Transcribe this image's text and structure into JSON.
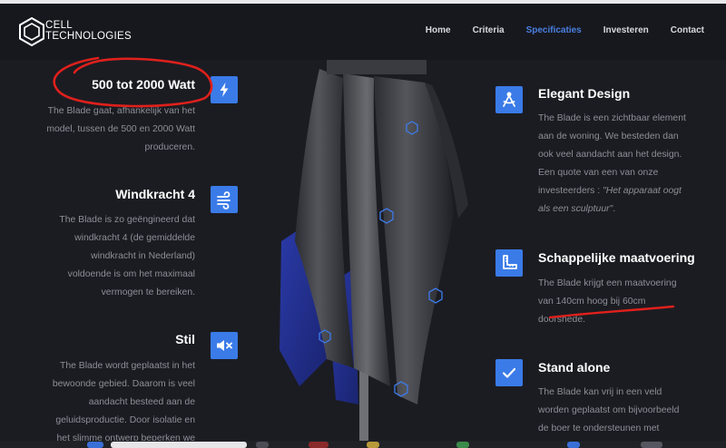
{
  "brand": {
    "line1": "CELL",
    "line2": "TECHNOLOGIES"
  },
  "nav": {
    "items": [
      "Home",
      "Criteria",
      "Specificaties",
      "Investeren",
      "Contact"
    ],
    "active": "Specificaties",
    "active_color": "#4a7fe0"
  },
  "left_features": [
    {
      "title": "500 tot 2000 Watt",
      "lines": [
        "The Blade gaat, afhankelijk van het",
        "model, tussen de 500 en 2000 Watt",
        "produceren."
      ],
      "icon": "lightning-icon"
    },
    {
      "title": "Windkracht 4",
      "lines": [
        "The Blade is zo geëngineerd dat",
        "windkracht 4 (de gemiddelde",
        "windkracht in Nederland)",
        "voldoende is om het maximaal",
        "vermogen te bereiken."
      ],
      "icon": "wind-icon"
    },
    {
      "title": "Stil",
      "lines": [
        "The Blade wordt geplaatst in het",
        "bewoonde gebied. Daarom is veel",
        "aandacht besteed aan de",
        "geluidsproductie. Door isolatie en",
        "het slimme ontwerp beperken we"
      ],
      "icon": "mute-icon"
    }
  ],
  "right_features": [
    {
      "title": "Elegant Design",
      "lines": [
        "The Blade is een zichtbaar element",
        "aan de woning. We besteden dan",
        "ook veel aandacht aan het design.",
        "Een quote van een van onze"
      ],
      "quote_prefix": "investeerders : ",
      "quote_a": "\"Het apparaat oogt",
      "quote_b": "als een sculptuur\"",
      "quote_suffix": ".",
      "icon": "compass-icon"
    },
    {
      "title": "Schappelijke maatvoering",
      "lines": [
        "The Blade krijgt een maatvoering",
        "van 140cm hoog bij 60cm",
        "doorsnede."
      ],
      "icon": "ruler-icon"
    },
    {
      "title": "Stand alone",
      "lines": [
        "The Blade kan vrij in een veld",
        "worden geplaatst om bijvoorbeeld",
        "de boer te ondersteunen met"
      ],
      "icon": "check-icon"
    }
  ],
  "colors": {
    "accent": "#3a7be8",
    "annotation": "#e0201c",
    "background": "#1b1c22"
  }
}
